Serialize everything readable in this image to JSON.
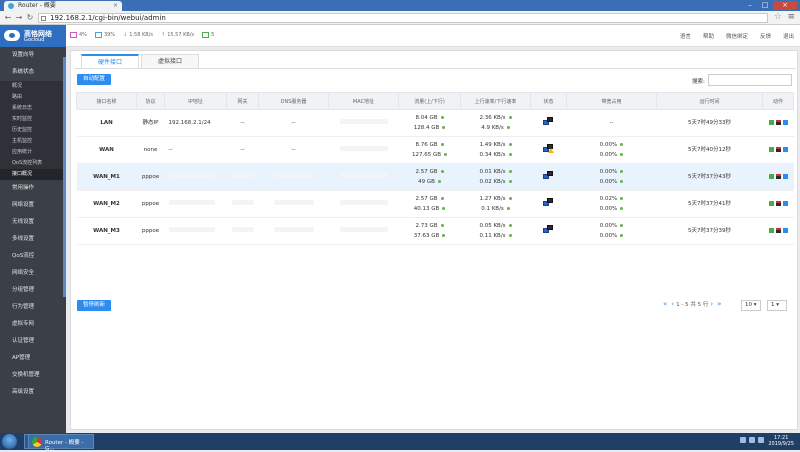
{
  "browser": {
    "tab_title": "Router - 概要",
    "url": "192.168.2.1/cgi-bin/webui/admin"
  },
  "brand": {
    "cn": "高恪网络",
    "en": "Gocloud"
  },
  "topbar": {
    "cpu": "4%",
    "mem": "39%",
    "down": "1.58 KB/s",
    "up": "15.57 KB/s",
    "online": "5",
    "links": [
      "语言",
      "帮助",
      "微信绑定",
      "反馈",
      "退出"
    ]
  },
  "sidebar": {
    "items_top": [
      "设置向导",
      "系统状态"
    ],
    "sub_items": [
      "概况",
      "路由",
      "系统日志",
      "实时监控",
      "历史监控",
      "主机监控",
      "应用统计",
      "QoS流控列表",
      "接口概况"
    ],
    "active_sub": 8,
    "items_bottom": [
      "常用操作",
      "网络设置",
      "无线设置",
      "多线设置",
      "QoS流控",
      "网络安全",
      "分组管理",
      "行为管理",
      "虚拟专网",
      "认证管理",
      "AP管理",
      "交换机管理",
      "高级设置"
    ]
  },
  "tabs": [
    "硬件接口",
    "虚拟接口"
  ],
  "toolbar": {
    "auto_config": "自动配置",
    "search_label": "搜索:"
  },
  "table": {
    "headers": [
      "接口名称",
      "协议",
      "IP地址",
      "网关",
      "DNS服务器",
      "MAC地址",
      "流量(上/下行)",
      "上行速率/下行速率",
      "状态",
      "带宽占用",
      "运行时间",
      "动作"
    ],
    "rows": [
      {
        "name": "LAN",
        "proto": "静态IP",
        "ip": "192.168.2.1/24",
        "gw": "--",
        "dns": "--",
        "traffic_up": "8.04 GB",
        "traffic_down": "128.4 GB",
        "rate_up": "2.36 KB/s",
        "rate_down": "4.9 KB/s",
        "bw_up": "",
        "bw_down": "--",
        "uptime": "5天7时49分33秒",
        "warn": false
      },
      {
        "name": "WAN",
        "proto": "none",
        "ip": "--",
        "gw": "--",
        "dns": "--",
        "traffic_up": "8.76 GB",
        "traffic_down": "127.65 GB",
        "rate_up": "1.49 KB/s",
        "rate_down": "0.34 KB/s",
        "bw_up": "0.00%",
        "bw_down": "0.00%",
        "uptime": "5天7时40分12秒",
        "warn": true
      },
      {
        "name": "WAN_M1",
        "proto": "pppoe",
        "ip": "",
        "gw": "",
        "dns": "",
        "traffic_up": "2.57 GB",
        "traffic_down": "49 GB",
        "rate_up": "0.01 KB/s",
        "rate_down": "0.02 KB/s",
        "bw_up": "0.00%",
        "bw_down": "0.00%",
        "uptime": "5天7时37分43秒",
        "warn": false
      },
      {
        "name": "WAN_M2",
        "proto": "pppoe",
        "ip": "",
        "gw": "",
        "dns": "",
        "traffic_up": "2.57 GB",
        "traffic_down": "40.13 GB",
        "rate_up": "1.27 KB/s",
        "rate_down": "0.1 KB/s",
        "bw_up": "0.02%",
        "bw_down": "0.00%",
        "uptime": "5天7时37分41秒",
        "warn": false
      },
      {
        "name": "WAN_M3",
        "proto": "pppoe",
        "ip": "",
        "gw": "",
        "dns": "",
        "traffic_up": "2.73 GB",
        "traffic_down": "37.63 GB",
        "rate_up": "0.05 KB/s",
        "rate_down": "0.11 KB/s",
        "bw_up": "0.00%",
        "bw_down": "0.00%",
        "uptime": "5天7时37分39秒",
        "warn": false
      }
    ]
  },
  "footer": {
    "refresh": "暂停刷新",
    "pager": "1 - 5 共 5 行",
    "page_size": "10",
    "page_num": "1"
  },
  "taskbar": {
    "item": "Router - 概要 - G...",
    "time": "17:21",
    "date": "2019/9/25"
  }
}
